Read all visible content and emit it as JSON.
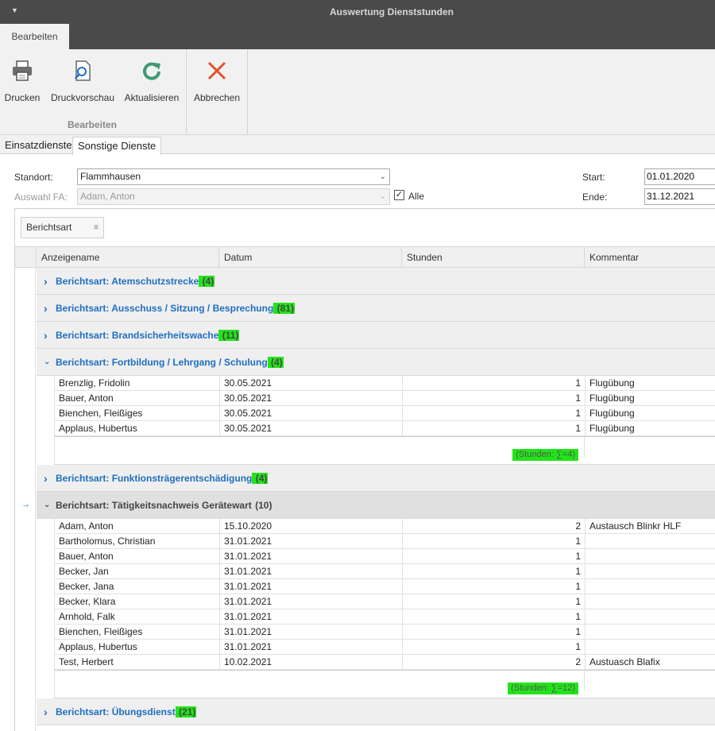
{
  "window": {
    "title": "Auswertung Dienststunden"
  },
  "ribbon": {
    "tab": "Bearbeiten",
    "buttons": [
      {
        "label": "Drucken",
        "icon": "printer-icon"
      },
      {
        "label": "Druckvorschau",
        "icon": "print-preview-icon"
      },
      {
        "label": "Aktualisieren",
        "icon": "refresh-icon"
      },
      {
        "label": "Abbrechen",
        "icon": "close-icon"
      }
    ],
    "group_label": "Bearbeiten"
  },
  "doc_tabs": [
    "Einsatzdienste",
    "Sonstige Dienste"
  ],
  "active_doc_tab": "Sonstige Dienste",
  "filters": {
    "standort_label": "Standort:",
    "standort_value": "Flammhausen",
    "fa_label": "Auswahl FA:",
    "fa_value": "Adam, Anton",
    "alle_label": "Alle",
    "alle_checked": true,
    "start_label": "Start:",
    "start_value": "01.01.2020",
    "ende_label": "Ende:",
    "ende_value": "31.12.2021"
  },
  "grid": {
    "group_panel_field": "Berichtsart",
    "columns": [
      "Anzeigename",
      "Datum",
      "Stunden",
      "Kommentar"
    ],
    "groups": [
      {
        "label": "Berichtsart: Atemschutzstrecke",
        "count": "(4)",
        "expanded": false
      },
      {
        "label": "Berichtsart: Ausschuss / Sitzung / Besprechung",
        "count": "(81)",
        "expanded": false
      },
      {
        "label": "Berichtsart: Brandsicherheitswache",
        "count": "(11)",
        "expanded": false
      },
      {
        "label": "Berichtsart: Fortbildung / Lehrgang / Schulung",
        "count": "(4)",
        "expanded": true,
        "rows": [
          {
            "name": "Brenzlig, Fridolin",
            "date": "30.05.2021",
            "hours": "1",
            "comment": "Flugübung"
          },
          {
            "name": "Bauer, Anton",
            "date": "30.05.2021",
            "hours": "1",
            "comment": "Flugübung"
          },
          {
            "name": "Bienchen, Fleißiges",
            "date": "30.05.2021",
            "hours": "1",
            "comment": "Flugübung"
          },
          {
            "name": "Applaus, Hubertus",
            "date": "30.05.2021",
            "hours": "1",
            "comment": "Flugübung"
          }
        ],
        "summary": "(Stunden: ∑=4)"
      },
      {
        "label": "Berichtsart: Funktionsträgerentschädigung",
        "count": "(4)",
        "expanded": false
      },
      {
        "label": "Berichtsart: Tätigkeitsnachweis Gerätewart",
        "count": "(10)",
        "expanded": true,
        "focused": true,
        "rows": [
          {
            "name": "Adam, Anton",
            "date": "15.10.2020",
            "hours": "2",
            "comment": "Austausch Blinkr HLF"
          },
          {
            "name": "Bartholomus, Christian",
            "date": "31.01.2021",
            "hours": "1",
            "comment": ""
          },
          {
            "name": "Bauer, Anton",
            "date": "31.01.2021",
            "hours": "1",
            "comment": ""
          },
          {
            "name": "Becker, Jan",
            "date": "31.01.2021",
            "hours": "1",
            "comment": ""
          },
          {
            "name": "Becker, Jana",
            "date": "31.01.2021",
            "hours": "1",
            "comment": ""
          },
          {
            "name": "Becker, Klara",
            "date": "31.01.2021",
            "hours": "1",
            "comment": ""
          },
          {
            "name": "Arnhold, Falk",
            "date": "31.01.2021",
            "hours": "1",
            "comment": ""
          },
          {
            "name": "Bienchen, Fleißiges",
            "date": "31.01.2021",
            "hours": "1",
            "comment": ""
          },
          {
            "name": "Applaus, Hubertus",
            "date": "31.01.2021",
            "hours": "1",
            "comment": ""
          },
          {
            "name": "Test, Herbert",
            "date": "10.02.2021",
            "hours": "2",
            "comment": "Austuasch Blafix"
          }
        ],
        "summary": "(Stunden: ∑=12)"
      },
      {
        "label": "Berichtsart: Übungsdienst",
        "count": "(21)",
        "expanded": false
      }
    ]
  },
  "colors": {
    "accent": "#1e6fc1",
    "highlight": "#22e41a",
    "titlebar": "#4a4a4a"
  }
}
